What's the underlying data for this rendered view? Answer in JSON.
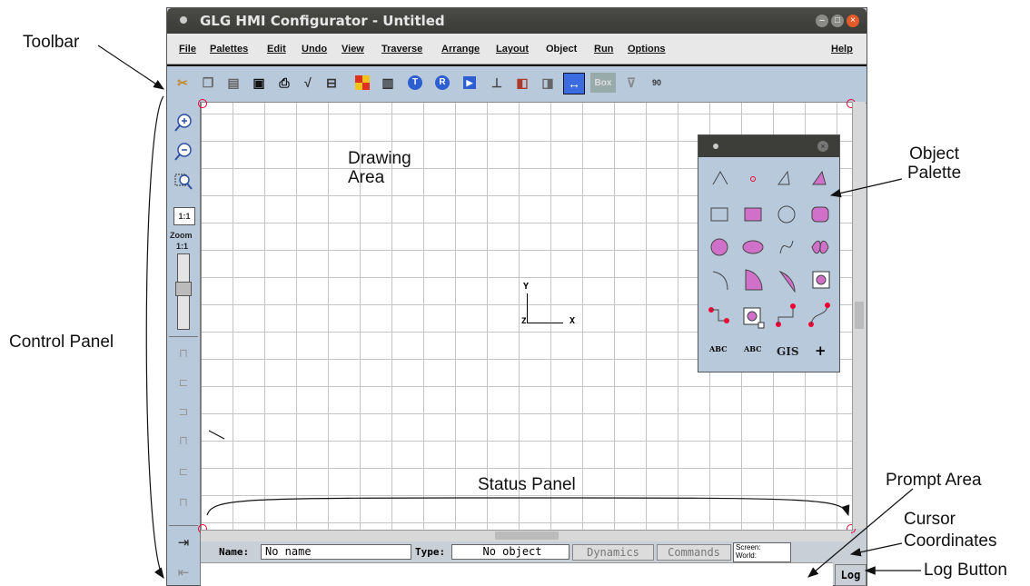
{
  "window": {
    "title": "GLG HMI Configurator - Untitled"
  },
  "menus": [
    "File",
    "Palettes",
    "Edit",
    "Undo",
    "View",
    "Traverse",
    "Arrange",
    "Layout",
    "Object",
    "Run",
    "Options"
  ],
  "help_menu": "Help",
  "toolbar": {
    "icons": [
      "cut-icon",
      "copy-icon",
      "paste-icon",
      "save-icon",
      "print-icon",
      "check-icon",
      "align-icon",
      "color-icon",
      "grid-icon",
      "t-icon",
      "r-icon",
      "run-icon",
      "axis-icon",
      "front-icon",
      "back-icon",
      "toggle-icon",
      "box-icon",
      "snap-icon",
      "rotate-icon"
    ],
    "box_label": "Box",
    "rotate_label": "90"
  },
  "control_panel": {
    "zoom_11_label": "1:1",
    "zoom_label": "Zoom",
    "zoom_ratio": "1:1"
  },
  "canvas": {
    "axis_y": "Y",
    "axis_x": "X",
    "axis_z": "Z"
  },
  "palette": {
    "abc1": "ABC",
    "abc2": "ABC",
    "gis": "GIS",
    "plus": "+"
  },
  "status": {
    "name_label": "Name:",
    "name_value": "No name",
    "type_label": "Type:",
    "type_value": "No object",
    "dynamics_button": "Dynamics",
    "commands_button": "Commands",
    "screen_label": "Screen:",
    "world_label": "World:"
  },
  "log_button": "Log",
  "annotations": {
    "toolbar": "Toolbar",
    "drawing_area": "Drawing\nArea",
    "object_palette": "Object\nPalette",
    "control_panel": "Control Panel",
    "status_panel": "Status Panel",
    "prompt_area": "Prompt Area",
    "cursor_coordinates": "Cursor\nCoordinates",
    "log_button": "Log Button"
  }
}
